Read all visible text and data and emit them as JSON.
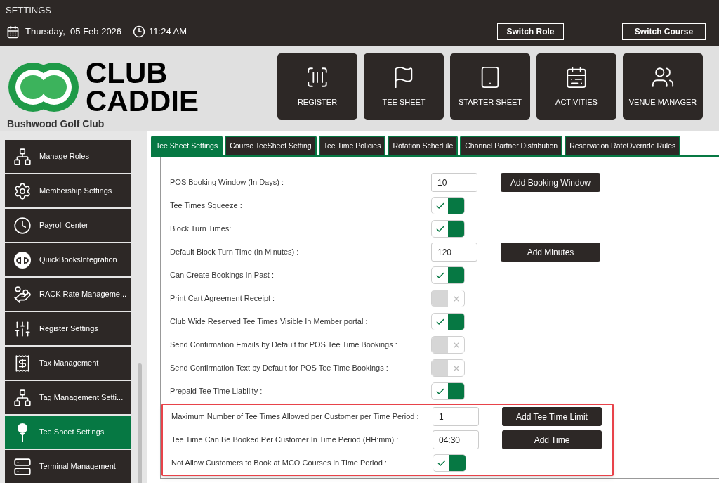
{
  "window": {
    "title": "SETTINGS"
  },
  "header": {
    "date": "Thursday,  05 Feb 2026",
    "time": "11:24 AM",
    "buttons": [
      "Switch Role",
      "Switch Course"
    ]
  },
  "logo": {
    "lines": [
      "CLUB",
      "CADDIE"
    ],
    "club_name": "Bushwood Golf Club"
  },
  "nav_tiles": [
    {
      "label": "REGISTER"
    },
    {
      "label": "TEE SHEET"
    },
    {
      "label": "STARTER SHEET"
    },
    {
      "label": "ACTIVITIES"
    },
    {
      "label": "VENUE MANAGER"
    }
  ],
  "sidebar": {
    "items": [
      {
        "label": "Manage Roles",
        "selected": false
      },
      {
        "label": "Membership Settings",
        "selected": false
      },
      {
        "label": "Payroll Center",
        "selected": false
      },
      {
        "label": "QuickBooksIntegration",
        "selected": false
      },
      {
        "label": "RACK Rate Manageme...",
        "selected": false
      },
      {
        "label": "Register Settings",
        "selected": false
      },
      {
        "label": "Tax Management",
        "selected": false
      },
      {
        "label": "Tag Management Setti...",
        "selected": false
      },
      {
        "label": "Tee Sheet Settings",
        "selected": true
      },
      {
        "label": "Terminal Management",
        "selected": false
      }
    ]
  },
  "tabs": [
    {
      "label": "Tee Sheet Settings",
      "selected": true
    },
    {
      "label": "Course TeeSheet Setting",
      "selected": false
    },
    {
      "label": "Tee Time Policies",
      "selected": false
    },
    {
      "label": "Rotation Schedule",
      "selected": false
    },
    {
      "label": "Channel Partner Distribution",
      "selected": false
    },
    {
      "label": "Reservation RateOverride Rules",
      "selected": false
    }
  ],
  "settings": [
    {
      "label": "POS Booking Window (In Days) :",
      "kind": "input",
      "value": "10",
      "button": "Add Booking Window"
    },
    {
      "label": "Tee Times Squeeze :",
      "kind": "toggle",
      "on": true
    },
    {
      "label": "Block Turn Times:",
      "kind": "toggle",
      "on": true
    },
    {
      "label": "Default Block Turn Time (in Minutes) :",
      "kind": "input",
      "value": "120",
      "button": "Add Minutes"
    },
    {
      "label": "Can Create Bookings In Past :",
      "kind": "toggle",
      "on": true
    },
    {
      "label": "Print Cart Agreement Receipt :",
      "kind": "toggle",
      "on": false
    },
    {
      "label": "Club Wide Reserved Tee Times Visible In Member portal :",
      "kind": "toggle",
      "on": true
    },
    {
      "label": "Send Confirmation Emails by Default for POS Tee Time Bookings :",
      "kind": "toggle",
      "on": false
    },
    {
      "label": "Send Confirmation Text by Default for POS Tee Time Bookings :",
      "kind": "toggle",
      "on": false
    },
    {
      "label": "Prepaid Tee Time Liability :",
      "kind": "toggle",
      "on": true
    }
  ],
  "highlighted_settings": [
    {
      "label": "Maximum Number of Tee Times Allowed per Customer per Time Period :",
      "kind": "input",
      "value": "1",
      "button": "Add Tee Time Limit"
    },
    {
      "label": "Tee Time Can Be Booked Per Customer In Time Period (HH:mm) :",
      "kind": "input",
      "value": "04:30",
      "button": "Add Time"
    },
    {
      "label": "Not Allow Customers to Book at MCO Courses in Time Period :",
      "kind": "toggle",
      "on": true
    }
  ]
}
